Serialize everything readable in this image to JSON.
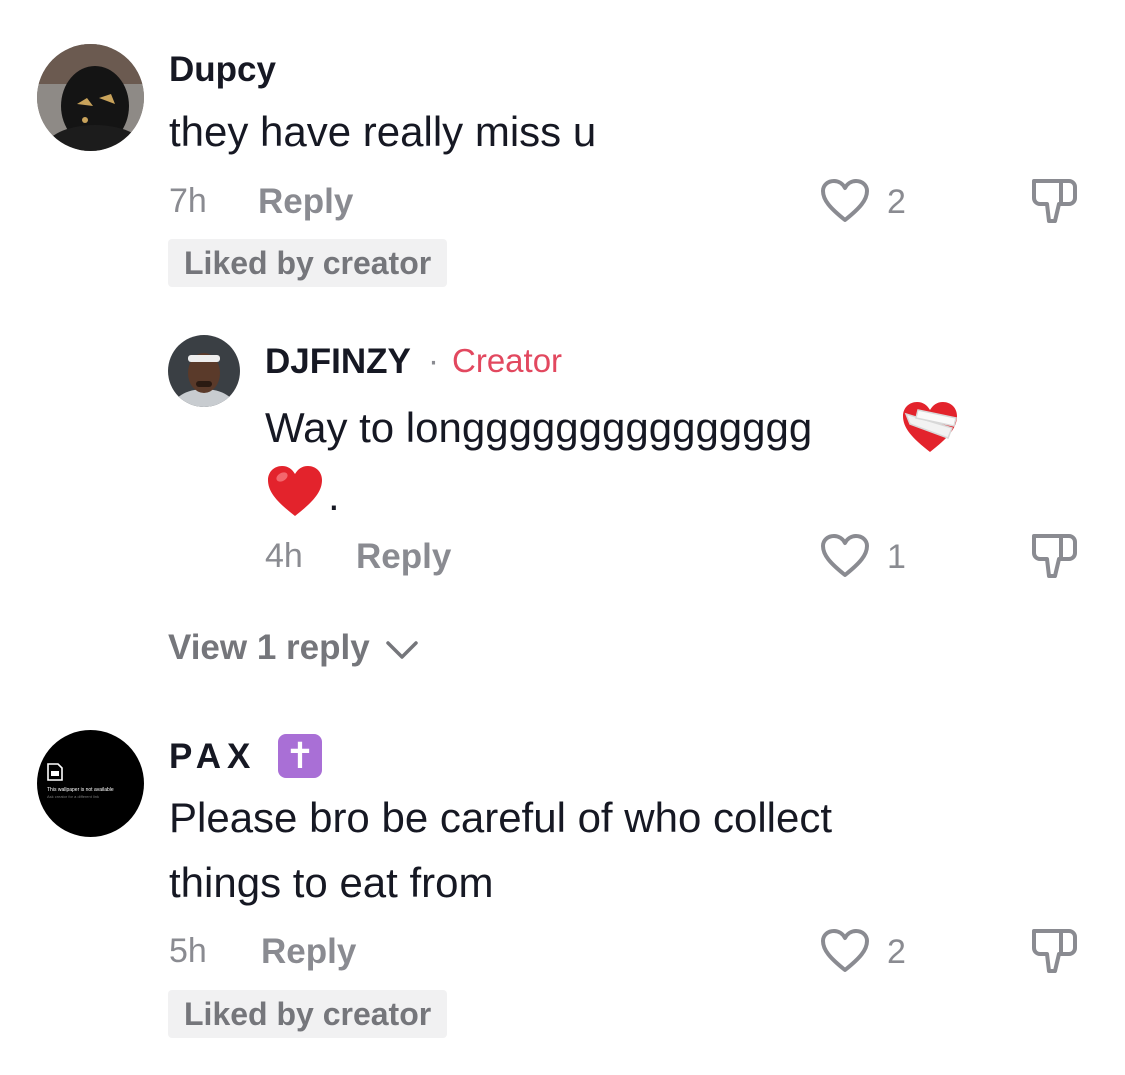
{
  "comments": [
    {
      "username": "Dupcy",
      "text": "they have really miss u",
      "time": "7h",
      "reply_label": "Reply",
      "likes": "2",
      "liked_by_creator": "Liked by creator",
      "avatar_icon": "masked-person-avatar"
    },
    {
      "username": "DJFINZY",
      "separator": "·",
      "creator_label": "Creator",
      "text_line1": "Way to longgggggggggggggg",
      "text_line2": ".",
      "time": "4h",
      "reply_label": "Reply",
      "likes": "1",
      "avatar_icon": "man-headband-avatar"
    },
    {
      "view_replies": "View 1 reply"
    },
    {
      "username": "PAX",
      "badge": "✝",
      "text_line1": "Please bro be careful of who collect",
      "text_line2": "things to eat from",
      "time": "5h",
      "reply_label": "Reply",
      "likes": "2",
      "liked_by_creator": "Liked by creator",
      "avatar_text_1": "This wallpaper is not available",
      "avatar_text_2": "Ask creator for a different link"
    }
  ],
  "colors": {
    "creator": "#e2485f",
    "muted": "#8a8b91",
    "badge_bg": "#a96fd6"
  }
}
